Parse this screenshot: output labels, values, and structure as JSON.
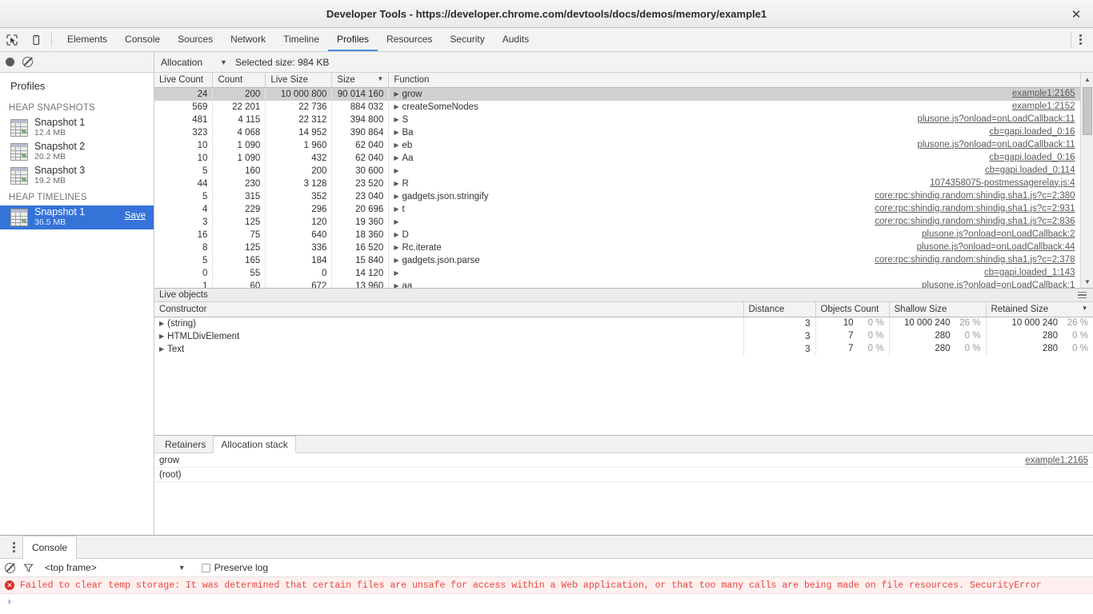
{
  "window": {
    "title": "Developer Tools - https://developer.chrome.com/devtools/docs/demos/memory/example1",
    "close_label": "✕"
  },
  "tabstrip": {
    "inspect_icon": "inspect-cursor-icon",
    "device_icon": "device-toolbar-icon",
    "tabs": [
      {
        "label": "Elements",
        "active": false
      },
      {
        "label": "Console",
        "active": false
      },
      {
        "label": "Sources",
        "active": false
      },
      {
        "label": "Network",
        "active": false
      },
      {
        "label": "Timeline",
        "active": false
      },
      {
        "label": "Profiles",
        "active": true
      },
      {
        "label": "Resources",
        "active": false
      },
      {
        "label": "Security",
        "active": false
      },
      {
        "label": "Audits",
        "active": false
      }
    ]
  },
  "sidebar": {
    "title": "Profiles",
    "groups": [
      {
        "label": "HEAP SNAPSHOTS",
        "items": [
          {
            "name": "Snapshot 1",
            "size": "12.4 MB",
            "selected": false,
            "save_label": ""
          },
          {
            "name": "Snapshot 2",
            "size": "20.2 MB",
            "selected": false,
            "save_label": ""
          },
          {
            "name": "Snapshot 3",
            "size": "19.2 MB",
            "selected": false,
            "save_label": ""
          }
        ]
      },
      {
        "label": "HEAP TIMELINES",
        "items": [
          {
            "name": "Snapshot 1",
            "size": "36.5 MB",
            "selected": true,
            "save_label": "Save"
          }
        ]
      }
    ]
  },
  "record_toolbar": {
    "record_label": "record-button",
    "clear_label": "clear-button"
  },
  "allocation_toolbar": {
    "view_label": "Allocation",
    "caret": "▼",
    "selected_size": "Selected size: 984 KB"
  },
  "top_grid": {
    "columns": [
      {
        "label": "Live Count",
        "sorted": false
      },
      {
        "label": "Count",
        "sorted": false
      },
      {
        "label": "Live Size",
        "sorted": false
      },
      {
        "label": "Size",
        "sorted": true
      },
      {
        "label": "Function",
        "sorted": false
      }
    ],
    "sort_arrow": "▼",
    "rows": [
      {
        "live_count": "24",
        "count": "200",
        "live_size": "10 000 800",
        "size": "90 014 160",
        "function": "grow",
        "link": "example1:2165",
        "selected": true
      },
      {
        "live_count": "569",
        "count": "22 201",
        "live_size": "22 736",
        "size": "884 032",
        "function": "createSomeNodes",
        "link": "example1:2152",
        "selected": false
      },
      {
        "live_count": "481",
        "count": "4 115",
        "live_size": "22 312",
        "size": "394 800",
        "function": "S",
        "link": "plusone.js?onload=onLoadCallback:11",
        "selected": false
      },
      {
        "live_count": "323",
        "count": "4 068",
        "live_size": "14 952",
        "size": "390 864",
        "function": "Ba",
        "link": "cb=gapi.loaded_0:16",
        "selected": false
      },
      {
        "live_count": "10",
        "count": "1 090",
        "live_size": "1 960",
        "size": "62 040",
        "function": "eb",
        "link": "plusone.js?onload=onLoadCallback:11",
        "selected": false
      },
      {
        "live_count": "10",
        "count": "1 090",
        "live_size": "432",
        "size": "62 040",
        "function": "Aa",
        "link": "cb=gapi.loaded_0:16",
        "selected": false
      },
      {
        "live_count": "5",
        "count": "160",
        "live_size": "200",
        "size": "30 600",
        "function": "",
        "link": "cb=gapi.loaded_0:114",
        "selected": false
      },
      {
        "live_count": "44",
        "count": "230",
        "live_size": "3 128",
        "size": "23 520",
        "function": "R",
        "link": "1074358075-postmessagerelay.js:4",
        "selected": false
      },
      {
        "live_count": "5",
        "count": "315",
        "live_size": "352",
        "size": "23 040",
        "function": "gadgets.json.stringify",
        "link": "core:rpc:shindig.random:shindig.sha1.js?c=2:380",
        "selected": false
      },
      {
        "live_count": "4",
        "count": "229",
        "live_size": "296",
        "size": "20 696",
        "function": "t",
        "link": "core:rpc:shindig.random:shindig.sha1.js?c=2:931",
        "selected": false
      },
      {
        "live_count": "3",
        "count": "125",
        "live_size": "120",
        "size": "19 360",
        "function": "",
        "link": "core:rpc:shindig.random:shindig.sha1.js?c=2:836",
        "selected": false
      },
      {
        "live_count": "16",
        "count": "75",
        "live_size": "640",
        "size": "18 360",
        "function": "D",
        "link": "plusone.js?onload=onLoadCallback:2",
        "selected": false
      },
      {
        "live_count": "8",
        "count": "125",
        "live_size": "336",
        "size": "16 520",
        "function": "Rc.iterate",
        "link": "plusone.js?onload=onLoadCallback:44",
        "selected": false
      },
      {
        "live_count": "5",
        "count": "165",
        "live_size": "184",
        "size": "15 840",
        "function": "gadgets.json.parse",
        "link": "core:rpc:shindig.random:shindig.sha1.js?c=2:378",
        "selected": false
      },
      {
        "live_count": "0",
        "count": "55",
        "live_size": "0",
        "size": "14 120",
        "function": "",
        "link": "cb=gapi.loaded_1:143",
        "selected": false
      },
      {
        "live_count": "1",
        "count": "60",
        "live_size": "672",
        "size": "13 960",
        "function": "aa",
        "link": "plusone.js?onload=onLoadCallback:1",
        "selected": false
      }
    ]
  },
  "live_objects": {
    "header": "Live objects",
    "menu_icon": "hamburger-menu-icon",
    "columns": [
      {
        "label": "Constructor",
        "sorted": false
      },
      {
        "label": "Distance",
        "sorted": false
      },
      {
        "label": "Objects Count",
        "sorted": false
      },
      {
        "label": "Shallow Size",
        "sorted": false
      },
      {
        "label": "Retained Size",
        "sorted": true
      }
    ],
    "sort_arrow": "▼",
    "rows": [
      {
        "constructor": "(string)",
        "distance": "3",
        "objects_count": "10",
        "objects_pct": "0 %",
        "shallow_size": "10 000 240",
        "shallow_pct": "26 %",
        "retained_size": "10 000 240",
        "retained_pct": "26 %"
      },
      {
        "constructor": "HTMLDivElement",
        "distance": "3",
        "objects_count": "7",
        "objects_pct": "0 %",
        "shallow_size": "280",
        "shallow_pct": "0 %",
        "retained_size": "280",
        "retained_pct": "0 %"
      },
      {
        "constructor": "Text",
        "distance": "3",
        "objects_count": "7",
        "objects_pct": "0 %",
        "shallow_size": "280",
        "shallow_pct": "0 %",
        "retained_size": "280",
        "retained_pct": "0 %"
      }
    ]
  },
  "bottom_tabs": {
    "tabs": [
      {
        "label": "Retainers",
        "active": false
      },
      {
        "label": "Allocation stack",
        "active": true
      }
    ],
    "stack_rows": [
      {
        "function": "grow",
        "link": "example1:2165"
      },
      {
        "function": "(root)",
        "link": ""
      }
    ]
  },
  "drawer": {
    "dots_icon": "more-options-icon",
    "tab_label": "Console",
    "clear_icon": "clear-console-icon",
    "filter_icon": "filter-funnel-icon",
    "context": "<top frame>",
    "context_caret": "▼",
    "preserve_log_label": "Preserve log",
    "preserve_log_checked": false,
    "error_message": "Failed to clear temp storage: It was determined that certain files are unsafe for access within a Web application, or that too many calls are being made on file resources. SecurityError",
    "error_icon": "error-circle-icon",
    "prompt_symbol": "›"
  },
  "colors": {
    "accent": "#4a90d9",
    "selection": "#3573d8",
    "error": "#e8453c",
    "link": "#5a5a5a"
  }
}
